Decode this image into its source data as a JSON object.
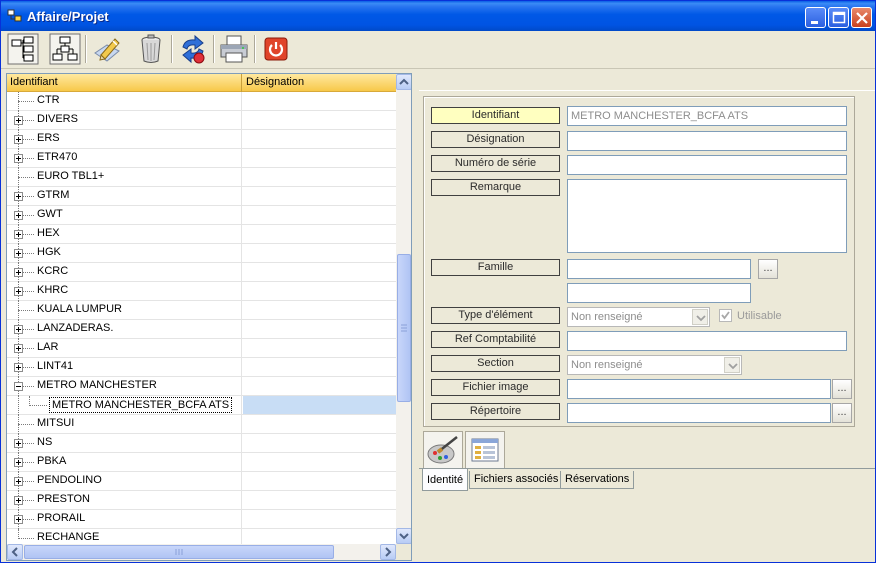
{
  "window": {
    "title": "Affaire/Projet"
  },
  "toolbar": {
    "buttons": [
      {
        "name": "expand-tree-icon"
      },
      {
        "name": "collapse-tree-icon"
      },
      {
        "name": "edit-icon"
      },
      {
        "name": "trash-icon"
      },
      {
        "name": "refresh-icon"
      },
      {
        "name": "print-icon"
      },
      {
        "name": "power-icon"
      }
    ]
  },
  "tree": {
    "columns": [
      "Identifiant",
      "Désignation"
    ],
    "rows": [
      {
        "label": "CTR",
        "expandable": false,
        "expanded": false,
        "level": 0,
        "selected": false
      },
      {
        "label": "DIVERS",
        "expandable": true,
        "expanded": false,
        "level": 0,
        "selected": false
      },
      {
        "label": "ERS",
        "expandable": true,
        "expanded": false,
        "level": 0,
        "selected": false
      },
      {
        "label": "ETR470",
        "expandable": true,
        "expanded": false,
        "level": 0,
        "selected": false
      },
      {
        "label": "EURO TBL1+",
        "expandable": false,
        "expanded": false,
        "level": 0,
        "selected": false
      },
      {
        "label": "GTRM",
        "expandable": true,
        "expanded": false,
        "level": 0,
        "selected": false
      },
      {
        "label": "GWT",
        "expandable": true,
        "expanded": false,
        "level": 0,
        "selected": false
      },
      {
        "label": "HEX",
        "expandable": true,
        "expanded": false,
        "level": 0,
        "selected": false
      },
      {
        "label": "HGK",
        "expandable": true,
        "expanded": false,
        "level": 0,
        "selected": false
      },
      {
        "label": "KCRC",
        "expandable": true,
        "expanded": false,
        "level": 0,
        "selected": false
      },
      {
        "label": "KHRC",
        "expandable": true,
        "expanded": false,
        "level": 0,
        "selected": false
      },
      {
        "label": "KUALA LUMPUR",
        "expandable": false,
        "expanded": false,
        "level": 0,
        "selected": false
      },
      {
        "label": "LANZADERAS.",
        "expandable": true,
        "expanded": false,
        "level": 0,
        "selected": false
      },
      {
        "label": "LAR",
        "expandable": true,
        "expanded": false,
        "level": 0,
        "selected": false
      },
      {
        "label": "LINT41",
        "expandable": true,
        "expanded": false,
        "level": 0,
        "selected": false
      },
      {
        "label": "METRO MANCHESTER",
        "expandable": true,
        "expanded": true,
        "level": 0,
        "selected": false
      },
      {
        "label": "METRO MANCHESTER_BCFA ATS",
        "expandable": false,
        "expanded": false,
        "level": 1,
        "selected": true
      },
      {
        "label": "MITSUI",
        "expandable": false,
        "expanded": false,
        "level": 0,
        "selected": false
      },
      {
        "label": "NS",
        "expandable": true,
        "expanded": false,
        "level": 0,
        "selected": false
      },
      {
        "label": "PBKA",
        "expandable": true,
        "expanded": false,
        "level": 0,
        "selected": false
      },
      {
        "label": "PENDOLINO",
        "expandable": true,
        "expanded": false,
        "level": 0,
        "selected": false
      },
      {
        "label": "PRESTON",
        "expandable": true,
        "expanded": false,
        "level": 0,
        "selected": false
      },
      {
        "label": "PRORAIL",
        "expandable": true,
        "expanded": false,
        "level": 0,
        "selected": false
      },
      {
        "label": "RECHANGE",
        "expandable": false,
        "expanded": false,
        "level": 0,
        "selected": false
      }
    ]
  },
  "form": {
    "identifiant_label": "Identifiant",
    "identifiant_value": "METRO MANCHESTER_BCFA ATS",
    "designation_label": "Désignation",
    "designation_value": "",
    "serie_label": "Numéro de série",
    "serie_value": "",
    "remarque_label": "Remarque",
    "remarque_value": "",
    "famille_label": "Famille",
    "famille_value": "",
    "famille_sub_value": "",
    "famille_button": "...",
    "type_label": "Type d'élément",
    "type_value": "Non renseigné",
    "utilisable_label": "Utilisable",
    "utilisable_checked": true,
    "ref_label": "Ref Comptabilité",
    "ref_value": "",
    "section_label": "Section",
    "section_value": "Non renseigné",
    "image_label": "Fichier image",
    "image_value": "",
    "image_button": "...",
    "repertoire_label": "Répertoire",
    "repertoire_value": "",
    "repertoire_button": "..."
  },
  "tabs": [
    {
      "label": "Identité",
      "active": true
    },
    {
      "label": "Fichiers associés",
      "active": false
    },
    {
      "label": "Réservations",
      "active": false
    }
  ],
  "colors": {
    "title_blue": "#0054E3",
    "header_gold": "#F7C84A",
    "selected_row": "#C8DDF5",
    "active_label": "#FFFFC0"
  }
}
